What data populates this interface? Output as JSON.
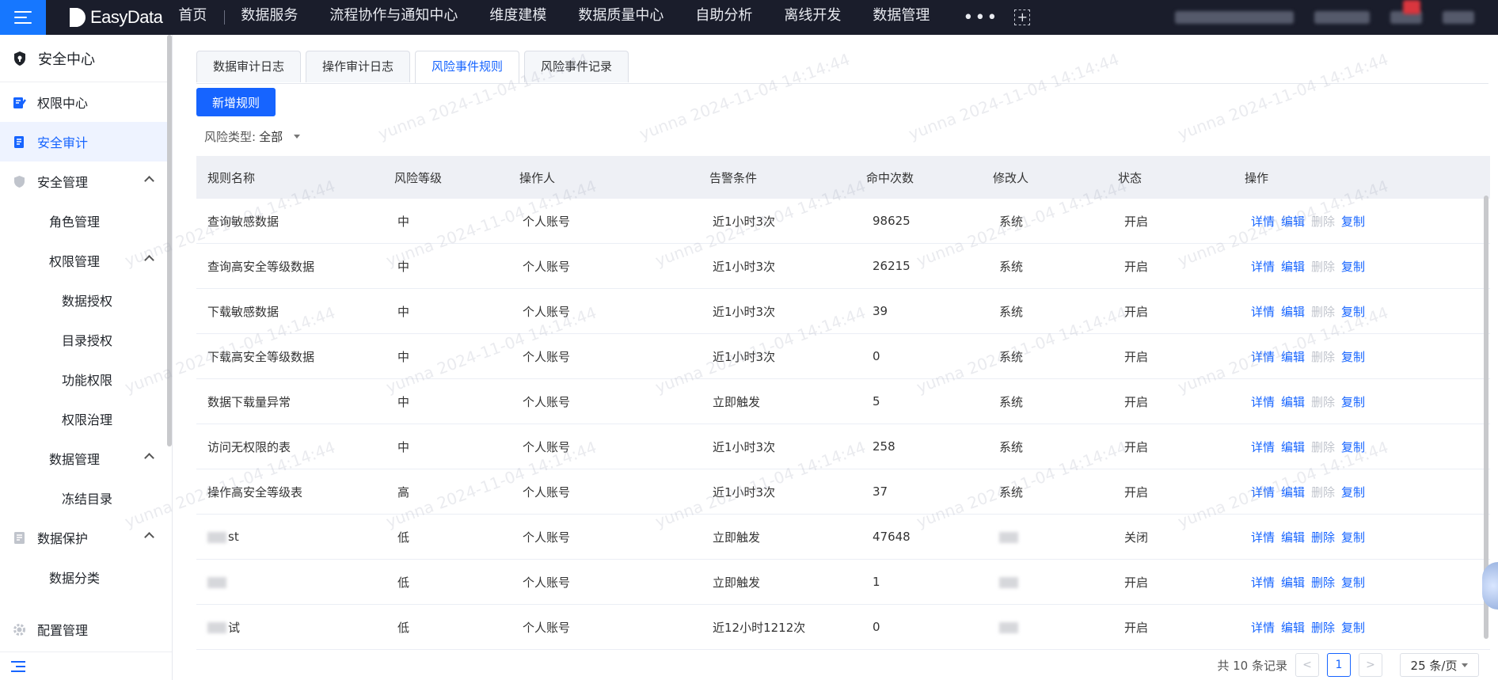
{
  "topbar": {
    "brand": "EasyData",
    "nav": [
      "首页",
      "数据服务",
      "流程协作与通知中心",
      "维度建模",
      "数据质量中心",
      "自助分析",
      "离线开发",
      "数据管理"
    ],
    "more": "•••",
    "plus": "+"
  },
  "sidebar": {
    "title": "安全中心",
    "items": [
      {
        "label": "权限中心"
      },
      {
        "label": "安全审计"
      },
      {
        "label": "安全管理"
      },
      {
        "label": "角色管理"
      },
      {
        "label": "权限管理"
      },
      {
        "label": "数据授权"
      },
      {
        "label": "目录授权"
      },
      {
        "label": "功能权限"
      },
      {
        "label": "权限治理"
      },
      {
        "label": "数据管理"
      },
      {
        "label": "冻结目录"
      },
      {
        "label": "数据保护"
      },
      {
        "label": "数据分类"
      },
      {
        "label": "配置管理"
      }
    ]
  },
  "tabs": [
    "数据审计日志",
    "操作审计日志",
    "风险事件规则",
    "风险事件记录"
  ],
  "add_button": "新增规则",
  "filter": {
    "label": "风险类型:",
    "value": "全部"
  },
  "table": {
    "headers": [
      "规则名称",
      "风险等级",
      "操作人",
      "告警条件",
      "命中次数",
      "修改人",
      "状态",
      "操作"
    ],
    "actions": [
      "详情",
      "编辑",
      "删除",
      "复制"
    ],
    "rows": [
      {
        "name": "查询敏感数据",
        "level": "中",
        "operator": "个人账号",
        "condition": "近1小时3次",
        "hits": "98625",
        "modifier": "系统",
        "status": "开启"
      },
      {
        "name": "查询高安全等级数据",
        "level": "中",
        "operator": "个人账号",
        "condition": "近1小时3次",
        "hits": "26215",
        "modifier": "系统",
        "status": "开启"
      },
      {
        "name": "下载敏感数据",
        "level": "中",
        "operator": "个人账号",
        "condition": "近1小时3次",
        "hits": "39",
        "modifier": "系统",
        "status": "开启"
      },
      {
        "name": "下载高安全等级数据",
        "level": "中",
        "operator": "个人账号",
        "condition": "近1小时3次",
        "hits": "0",
        "modifier": "系统",
        "status": "开启"
      },
      {
        "name": "数据下载量异常",
        "level": "中",
        "operator": "个人账号",
        "condition": "立即触发",
        "hits": "5",
        "modifier": "系统",
        "status": "开启"
      },
      {
        "name": "访问无权限的表",
        "level": "中",
        "operator": "个人账号",
        "condition": "近1小时3次",
        "hits": "258",
        "modifier": "系统",
        "status": "开启"
      },
      {
        "name": "操作高安全等级表",
        "level": "高",
        "operator": "个人账号",
        "condition": "近1小时3次",
        "hits": "37",
        "modifier": "系统",
        "status": "开启"
      },
      {
        "name": "st",
        "level": "低",
        "operator": "个人账号",
        "condition": "立即触发",
        "hits": "47648",
        "modifier": "",
        "status": "关闭"
      },
      {
        "name": "",
        "level": "低",
        "operator": "个人账号",
        "condition": "立即触发",
        "hits": "1",
        "modifier": "",
        "status": "开启"
      },
      {
        "name": "试",
        "level": "低",
        "operator": "个人账号",
        "condition": "近12小时1212次",
        "hits": "0",
        "modifier": "",
        "status": "开启"
      }
    ]
  },
  "pagination": {
    "total": "共 10 条记录",
    "prev": "<",
    "current": "1",
    "next": ">",
    "size": "25 条/页"
  },
  "watermark": "yunna 2024-11-04 14:14:44",
  "colors": {
    "accent": "#1664ff",
    "topbar": "#1a1d2b",
    "menu_button": "#1677ff"
  }
}
